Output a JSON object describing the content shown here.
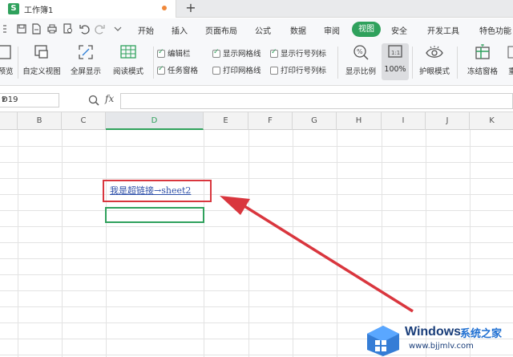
{
  "tabs": {
    "app_icon": "S",
    "document_title": "工作簿1",
    "new_tab": "+"
  },
  "menu": {
    "items": [
      "开始",
      "插入",
      "页面布局",
      "公式",
      "数据",
      "审阅",
      "视图",
      "安全",
      "开发工具",
      "特色功能"
    ],
    "active": "视图"
  },
  "ribbon": {
    "buttons": {
      "preview": "预览",
      "custom_view": "自定义视图",
      "fullscreen": "全屏显示",
      "reading_mode": "阅读模式",
      "zoom_ratio": "显示比例",
      "zoom_100": "100%",
      "eye_mode": "护眼模式",
      "freeze": "冻结窗格",
      "more": "重"
    },
    "checkboxes": {
      "edit_bar": "编辑栏",
      "task_pane": "任务窗格",
      "show_gridlines": "显示网格线",
      "print_gridlines": "打印网格线",
      "show_headers": "显示行号列标",
      "print_headers": "打印行号列标"
    }
  },
  "formula_bar": {
    "name_box": "D19",
    "fx": "fx",
    "value": ""
  },
  "grid": {
    "columns": [
      "B",
      "C",
      "D",
      "E",
      "F",
      "G",
      "H",
      "I",
      "J",
      "K"
    ],
    "active_column": "D",
    "hyperlink_cell": "我是超链接→sheet2"
  },
  "watermark": {
    "brand": "Windows",
    "cn": "系统之家",
    "url": "www.bjjmlv.com"
  },
  "colors": {
    "accent": "#2fa15c",
    "annotation": "#d9363e",
    "link": "#2d4fa8"
  }
}
